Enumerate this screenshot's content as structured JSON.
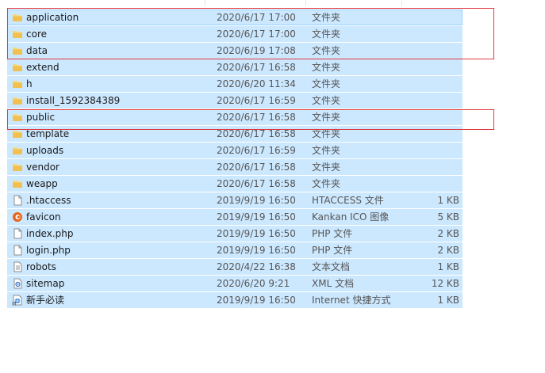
{
  "files": [
    {
      "name": "application",
      "date": "2020/6/17 17:00",
      "type": "文件夹",
      "size": "",
      "icon": "folder-icon"
    },
    {
      "name": "core",
      "date": "2020/6/17 17:00",
      "type": "文件夹",
      "size": "",
      "icon": "folder-icon"
    },
    {
      "name": "data",
      "date": "2020/6/19 17:08",
      "type": "文件夹",
      "size": "",
      "icon": "folder-icon"
    },
    {
      "name": "extend",
      "date": "2020/6/17 16:58",
      "type": "文件夹",
      "size": "",
      "icon": "folder-icon"
    },
    {
      "name": "h",
      "date": "2020/6/20 11:34",
      "type": "文件夹",
      "size": "",
      "icon": "folder-icon"
    },
    {
      "name": "install_1592384389",
      "date": "2020/6/17 16:59",
      "type": "文件夹",
      "size": "",
      "icon": "folder-icon"
    },
    {
      "name": "public",
      "date": "2020/6/17 16:58",
      "type": "文件夹",
      "size": "",
      "icon": "folder-icon"
    },
    {
      "name": "template",
      "date": "2020/6/17 16:58",
      "type": "文件夹",
      "size": "",
      "icon": "folder-icon"
    },
    {
      "name": "uploads",
      "date": "2020/6/17 16:59",
      "type": "文件夹",
      "size": "",
      "icon": "folder-icon"
    },
    {
      "name": "vendor",
      "date": "2020/6/17 16:58",
      "type": "文件夹",
      "size": "",
      "icon": "folder-icon"
    },
    {
      "name": "weapp",
      "date": "2020/6/17 16:58",
      "type": "文件夹",
      "size": "",
      "icon": "folder-icon"
    },
    {
      "name": ".htaccess",
      "date": "2019/9/19 16:50",
      "type": "HTACCESS 文件",
      "size": "1 KB",
      "icon": "file-icon"
    },
    {
      "name": "favicon",
      "date": "2019/9/19 16:50",
      "type": "Kankan ICO 图像",
      "size": "5 KB",
      "icon": "kankan-icon"
    },
    {
      "name": "index.php",
      "date": "2019/9/19 16:50",
      "type": "PHP 文件",
      "size": "2 KB",
      "icon": "file-icon"
    },
    {
      "name": "login.php",
      "date": "2019/9/19 16:50",
      "type": "PHP 文件",
      "size": "2 KB",
      "icon": "file-icon"
    },
    {
      "name": "robots",
      "date": "2020/4/22 16:38",
      "type": "文本文档",
      "size": "1 KB",
      "icon": "text-file-icon"
    },
    {
      "name": "sitemap",
      "date": "2020/6/20 9:21",
      "type": "XML 文档",
      "size": "12 KB",
      "icon": "xml-file-icon"
    },
    {
      "name": "新手必读",
      "date": "2019/9/19 16:50",
      "type": "Internet 快捷方式",
      "size": "1 KB",
      "icon": "internet-shortcut-icon"
    }
  ],
  "colors": {
    "selection": "#cce8ff",
    "annotation": "#e0393e",
    "folder": "#f8d775"
  }
}
